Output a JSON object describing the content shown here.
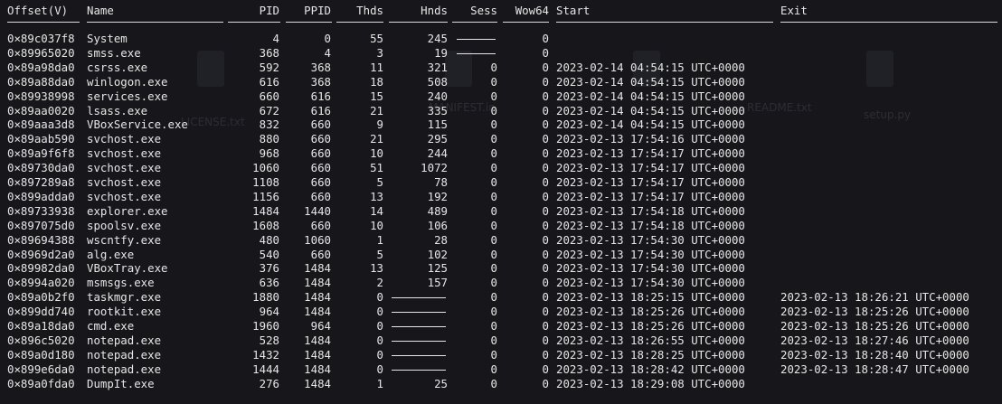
{
  "columns": {
    "offset": "Offset(V)",
    "name": "Name",
    "pid": "PID",
    "ppid": "PPID",
    "thds": "Thds",
    "hnds": "Hnds",
    "sess": "Sess",
    "wow64": "Wow64",
    "start": "Start",
    "exit": "Exit"
  },
  "background_labels": [
    "LICENSE.txt",
    "MANIFEST.in",
    "README.txt",
    "setup.py"
  ],
  "rows": [
    {
      "offset": "0×89c037f8",
      "name": "System",
      "pid": "4",
      "ppid": "0",
      "thds": "55",
      "hnds": "245",
      "sess": "",
      "wow64": "0",
      "start": "",
      "exit": ""
    },
    {
      "offset": "0×89965020",
      "name": "smss.exe",
      "pid": "368",
      "ppid": "4",
      "thds": "3",
      "hnds": "19",
      "sess": "",
      "wow64": "0",
      "start": "",
      "exit": ""
    },
    {
      "offset": "0×89a98da0",
      "name": "csrss.exe",
      "pid": "592",
      "ppid": "368",
      "thds": "11",
      "hnds": "321",
      "sess": "0",
      "wow64": "0",
      "start": "2023-02-14 04:54:15 UTC+0000",
      "exit": ""
    },
    {
      "offset": "0×89a88da0",
      "name": "winlogon.exe",
      "pid": "616",
      "ppid": "368",
      "thds": "18",
      "hnds": "508",
      "sess": "0",
      "wow64": "0",
      "start": "2023-02-14 04:54:15 UTC+0000",
      "exit": ""
    },
    {
      "offset": "0×89938998",
      "name": "services.exe",
      "pid": "660",
      "ppid": "616",
      "thds": "15",
      "hnds": "240",
      "sess": "0",
      "wow64": "0",
      "start": "2023-02-14 04:54:15 UTC+0000",
      "exit": ""
    },
    {
      "offset": "0×89aa0020",
      "name": "lsass.exe",
      "pid": "672",
      "ppid": "616",
      "thds": "21",
      "hnds": "335",
      "sess": "0",
      "wow64": "0",
      "start": "2023-02-14 04:54:15 UTC+0000",
      "exit": ""
    },
    {
      "offset": "0×89aaa3d8",
      "name": "VBoxService.exe",
      "pid": "832",
      "ppid": "660",
      "thds": "9",
      "hnds": "115",
      "sess": "0",
      "wow64": "0",
      "start": "2023-02-14 04:54:15 UTC+0000",
      "exit": ""
    },
    {
      "offset": "0×89aab590",
      "name": "svchost.exe",
      "pid": "880",
      "ppid": "660",
      "thds": "21",
      "hnds": "295",
      "sess": "0",
      "wow64": "0",
      "start": "2023-02-13 17:54:16 UTC+0000",
      "exit": ""
    },
    {
      "offset": "0×89a9f6f8",
      "name": "svchost.exe",
      "pid": "968",
      "ppid": "660",
      "thds": "10",
      "hnds": "244",
      "sess": "0",
      "wow64": "0",
      "start": "2023-02-13 17:54:17 UTC+0000",
      "exit": ""
    },
    {
      "offset": "0×89730da0",
      "name": "svchost.exe",
      "pid": "1060",
      "ppid": "660",
      "thds": "51",
      "hnds": "1072",
      "sess": "0",
      "wow64": "0",
      "start": "2023-02-13 17:54:17 UTC+0000",
      "exit": ""
    },
    {
      "offset": "0×897289a8",
      "name": "svchost.exe",
      "pid": "1108",
      "ppid": "660",
      "thds": "5",
      "hnds": "78",
      "sess": "0",
      "wow64": "0",
      "start": "2023-02-13 17:54:17 UTC+0000",
      "exit": ""
    },
    {
      "offset": "0×899adda0",
      "name": "svchost.exe",
      "pid": "1156",
      "ppid": "660",
      "thds": "13",
      "hnds": "192",
      "sess": "0",
      "wow64": "0",
      "start": "2023-02-13 17:54:17 UTC+0000",
      "exit": ""
    },
    {
      "offset": "0×89733938",
      "name": "explorer.exe",
      "pid": "1484",
      "ppid": "1440",
      "thds": "14",
      "hnds": "489",
      "sess": "0",
      "wow64": "0",
      "start": "2023-02-13 17:54:18 UTC+0000",
      "exit": ""
    },
    {
      "offset": "0×897075d0",
      "name": "spoolsv.exe",
      "pid": "1608",
      "ppid": "660",
      "thds": "10",
      "hnds": "106",
      "sess": "0",
      "wow64": "0",
      "start": "2023-02-13 17:54:18 UTC+0000",
      "exit": ""
    },
    {
      "offset": "0×89694388",
      "name": "wscntfy.exe",
      "pid": "480",
      "ppid": "1060",
      "thds": "1",
      "hnds": "28",
      "sess": "0",
      "wow64": "0",
      "start": "2023-02-13 17:54:30 UTC+0000",
      "exit": ""
    },
    {
      "offset": "0×8969d2a0",
      "name": "alg.exe",
      "pid": "540",
      "ppid": "660",
      "thds": "5",
      "hnds": "102",
      "sess": "0",
      "wow64": "0",
      "start": "2023-02-13 17:54:30 UTC+0000",
      "exit": ""
    },
    {
      "offset": "0×89982da0",
      "name": "VBoxTray.exe",
      "pid": "376",
      "ppid": "1484",
      "thds": "13",
      "hnds": "125",
      "sess": "0",
      "wow64": "0",
      "start": "2023-02-13 17:54:30 UTC+0000",
      "exit": ""
    },
    {
      "offset": "0×8994a020",
      "name": "msmsgs.exe",
      "pid": "636",
      "ppid": "1484",
      "thds": "2",
      "hnds": "157",
      "sess": "0",
      "wow64": "0",
      "start": "2023-02-13 17:54:30 UTC+0000",
      "exit": ""
    },
    {
      "offset": "0×89a0b2f0",
      "name": "taskmgr.exe",
      "pid": "1880",
      "ppid": "1484",
      "thds": "0",
      "hnds": "",
      "sess": "0",
      "wow64": "0",
      "start": "2023-02-13 18:25:15 UTC+0000",
      "exit": "2023-02-13 18:26:21 UTC+0000"
    },
    {
      "offset": "0×899dd740",
      "name": "rootkit.exe",
      "pid": "964",
      "ppid": "1484",
      "thds": "0",
      "hnds": "",
      "sess": "0",
      "wow64": "0",
      "start": "2023-02-13 18:25:26 UTC+0000",
      "exit": "2023-02-13 18:25:26 UTC+0000"
    },
    {
      "offset": "0×89a18da0",
      "name": "cmd.exe",
      "pid": "1960",
      "ppid": "964",
      "thds": "0",
      "hnds": "",
      "sess": "0",
      "wow64": "0",
      "start": "2023-02-13 18:25:26 UTC+0000",
      "exit": "2023-02-13 18:25:26 UTC+0000"
    },
    {
      "offset": "0×896c5020",
      "name": "notepad.exe",
      "pid": "528",
      "ppid": "1484",
      "thds": "0",
      "hnds": "",
      "sess": "0",
      "wow64": "0",
      "start": "2023-02-13 18:26:55 UTC+0000",
      "exit": "2023-02-13 18:27:46 UTC+0000"
    },
    {
      "offset": "0×89a0d180",
      "name": "notepad.exe",
      "pid": "1432",
      "ppid": "1484",
      "thds": "0",
      "hnds": "",
      "sess": "0",
      "wow64": "0",
      "start": "2023-02-13 18:28:25 UTC+0000",
      "exit": "2023-02-13 18:28:40 UTC+0000"
    },
    {
      "offset": "0×899e6da0",
      "name": "notepad.exe",
      "pid": "1444",
      "ppid": "1484",
      "thds": "0",
      "hnds": "",
      "sess": "0",
      "wow64": "0",
      "start": "2023-02-13 18:28:42 UTC+0000",
      "exit": "2023-02-13 18:28:47 UTC+0000"
    },
    {
      "offset": "0×89a0fda0",
      "name": "DumpIt.exe",
      "pid": "276",
      "ppid": "1484",
      "thds": "1",
      "hnds": "25",
      "sess": "0",
      "wow64": "0",
      "start": "2023-02-13 18:29:08 UTC+0000",
      "exit": ""
    }
  ]
}
